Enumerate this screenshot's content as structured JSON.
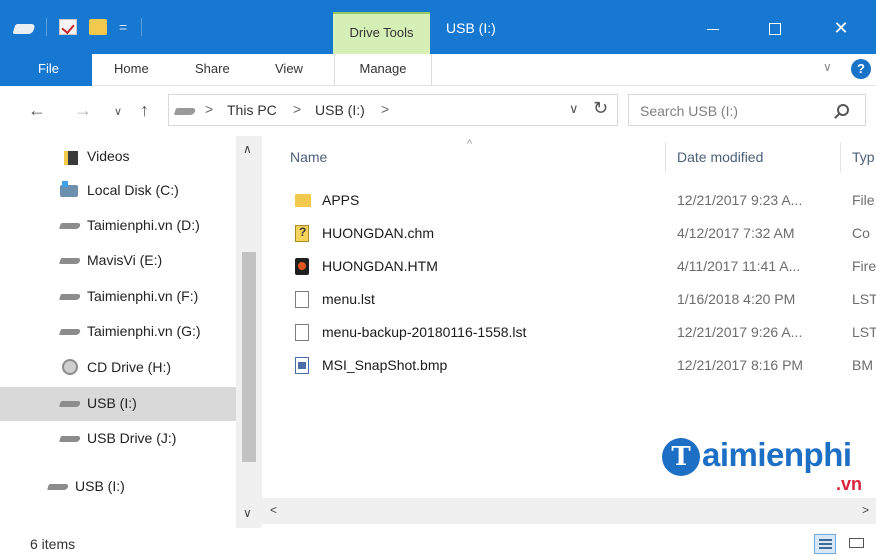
{
  "window": {
    "title": "USB (I:)",
    "context_tab": "Drive Tools",
    "minimize_glyph": "—",
    "maximize_glyph": "☐",
    "close_glyph": "✕"
  },
  "ribbon": {
    "tabs": [
      "File",
      "Home",
      "Share",
      "View",
      "Manage"
    ],
    "collapse_glyph": "∨",
    "help_glyph": "?"
  },
  "nav": {
    "back_glyph": "←",
    "forward_glyph": "→",
    "recent_glyph": "∨",
    "up_glyph": "↑"
  },
  "address": {
    "segments": [
      "This PC",
      "USB (I:)"
    ],
    "chevron": ">",
    "dropdown_glyph": "∨",
    "refresh_glyph": "↻"
  },
  "search": {
    "placeholder": "Search USB (I:)"
  },
  "navpane": {
    "items": [
      {
        "label": "Videos",
        "icon": "videos-folder-icon"
      },
      {
        "label": "Local Disk (C:)",
        "icon": "local-disk-icon"
      },
      {
        "label": "Taimienphi.vn (D:)",
        "icon": "drive-icon"
      },
      {
        "label": "MavisVi (E:)",
        "icon": "drive-icon"
      },
      {
        "label": "Taimienphi.vn (F:)",
        "icon": "drive-icon"
      },
      {
        "label": "Taimienphi.vn (G:)",
        "icon": "drive-icon"
      },
      {
        "label": "CD Drive (H:)",
        "icon": "cd-drive-icon"
      },
      {
        "label": "USB (I:)",
        "icon": "usb-drive-icon",
        "selected": true
      },
      {
        "label": "USB Drive (J:)",
        "icon": "usb-drive-icon"
      },
      {
        "label": "USB (I:)",
        "icon": "usb-drive-icon"
      }
    ],
    "scroll_up_glyph": "∧",
    "scroll_down_glyph": "∨"
  },
  "columns": {
    "name": "Name",
    "date": "Date modified",
    "type": "Typ",
    "sort_glyph": "^"
  },
  "files": [
    {
      "name": "APPS",
      "date": "12/21/2017 9:23 A...",
      "type": "File",
      "icon": "folder-icon"
    },
    {
      "name": "HUONGDAN.chm",
      "date": "4/12/2017 7:32 AM",
      "type": "Co",
      "icon": "chm-help-icon"
    },
    {
      "name": "HUONGDAN.HTM",
      "date": "4/11/2017 11:41 A...",
      "type": "Fire",
      "icon": "html-file-icon"
    },
    {
      "name": "menu.lst",
      "date": "1/16/2018 4:20 PM",
      "type": "LST",
      "icon": "text-file-icon"
    },
    {
      "name": "menu-backup-20180116-1558.lst",
      "date": "12/21/2017 9:26 A...",
      "type": "LST",
      "icon": "text-file-icon"
    },
    {
      "name": "MSI_SnapShot.bmp",
      "date": "12/21/2017 8:16 PM",
      "type": "BM",
      "icon": "bitmap-file-icon"
    }
  ],
  "hscroll": {
    "left_glyph": "<",
    "right_glyph": ">"
  },
  "watermark": {
    "logo_letter": "T",
    "text": "aimienphi",
    "suffix": ".vn"
  },
  "status": {
    "item_count": "6 items"
  },
  "colors": {
    "titlebar": "#1778d2",
    "drive_tools_tab": "#d6efb6",
    "selection": "#d9d9d9",
    "watermark_blue": "#1c6fc4",
    "watermark_red": "#d9233b"
  }
}
